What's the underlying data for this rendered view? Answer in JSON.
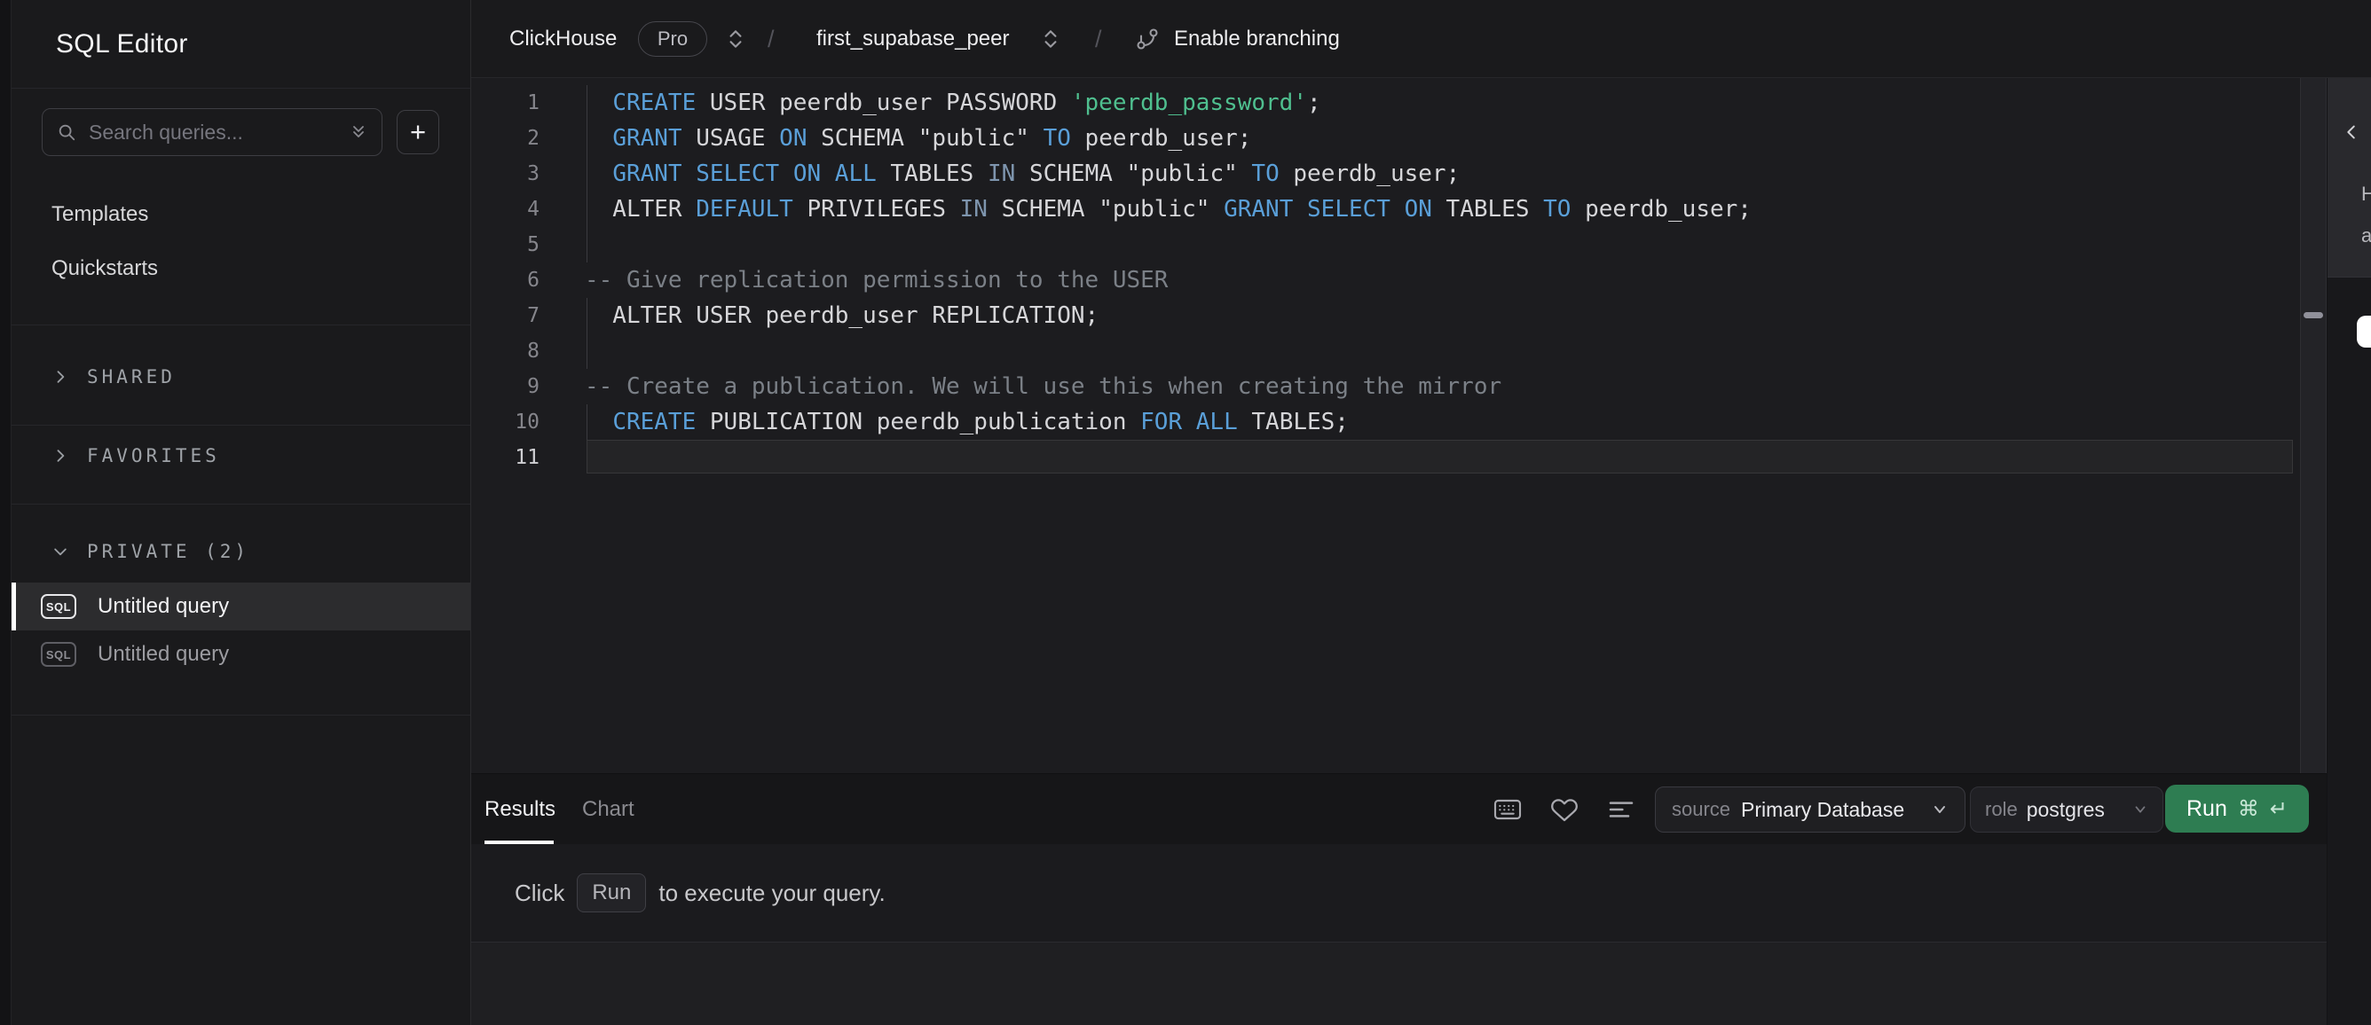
{
  "app": {
    "title": "SQL Editor"
  },
  "topbar": {
    "service": "ClickHouse",
    "plan": "Pro",
    "separator": "/",
    "database": "first_supabase_peer",
    "branching": "Enable branching"
  },
  "sidebar": {
    "search_placeholder": "Search queries...",
    "new_query": "+",
    "nav": [
      {
        "label": "Templates"
      },
      {
        "label": "Quickstarts"
      }
    ],
    "sections": [
      {
        "label": "SHARED"
      },
      {
        "label": "FAVORITES"
      },
      {
        "label": "PRIVATE (2)"
      }
    ],
    "queries": [
      {
        "badge": "SQL",
        "label": "Untitled query",
        "selected": true
      },
      {
        "badge": "SQL",
        "label": "Untitled query",
        "selected": false
      }
    ]
  },
  "editor": {
    "lines": [
      {
        "no": "1",
        "guide": true,
        "tokens": [
          [
            "  ",
            "d"
          ],
          [
            "CREATE",
            "kw"
          ],
          [
            " USER peerdb_user PASSWORD ",
            "d"
          ],
          [
            "'peerdb_password'",
            "str"
          ],
          [
            ";",
            "d"
          ]
        ]
      },
      {
        "no": "2",
        "guide": true,
        "tokens": [
          [
            "  ",
            "d"
          ],
          [
            "GRANT",
            "kw"
          ],
          [
            " USAGE ",
            "d"
          ],
          [
            "ON",
            "kw"
          ],
          [
            " SCHEMA \"public\" ",
            "d"
          ],
          [
            "TO",
            "kw"
          ],
          [
            " peerdb_user;",
            "d"
          ]
        ]
      },
      {
        "no": "3",
        "guide": true,
        "tokens": [
          [
            "  ",
            "d"
          ],
          [
            "GRANT",
            "kw"
          ],
          [
            " ",
            "d"
          ],
          [
            "SELECT",
            "kw"
          ],
          [
            " ",
            "d"
          ],
          [
            "ON",
            "kw"
          ],
          [
            " ",
            "d"
          ],
          [
            "ALL",
            "kw"
          ],
          [
            " TABLES ",
            "d"
          ],
          [
            "IN",
            "kw2"
          ],
          [
            " SCHEMA \"public\" ",
            "d"
          ],
          [
            "TO",
            "kw"
          ],
          [
            " peerdb_user;",
            "d"
          ]
        ]
      },
      {
        "no": "4",
        "guide": true,
        "tokens": [
          [
            "  ALTER ",
            "d"
          ],
          [
            "DEFAULT",
            "kw"
          ],
          [
            " PRIVILEGES ",
            "d"
          ],
          [
            "IN",
            "kw2"
          ],
          [
            " SCHEMA \"public\" ",
            "d"
          ],
          [
            "GRANT",
            "kw"
          ],
          [
            " ",
            "d"
          ],
          [
            "SELECT",
            "kw"
          ],
          [
            " ",
            "d"
          ],
          [
            "ON",
            "kw"
          ],
          [
            " TABLES ",
            "d"
          ],
          [
            "TO",
            "kw"
          ],
          [
            " peerdb_user;",
            "d"
          ]
        ]
      },
      {
        "no": "5",
        "guide": true,
        "tokens": []
      },
      {
        "no": "6",
        "guide": false,
        "tokens": [
          [
            "-- Give replication permission to the USER",
            "com"
          ]
        ]
      },
      {
        "no": "7",
        "guide": true,
        "tokens": [
          [
            "  ALTER USER peerdb_user REPLICATION;",
            "d"
          ]
        ]
      },
      {
        "no": "8",
        "guide": true,
        "tokens": []
      },
      {
        "no": "9",
        "guide": false,
        "tokens": [
          [
            "-- Create a publication. We will use this when creating the mirror",
            "com"
          ]
        ]
      },
      {
        "no": "10",
        "guide": true,
        "tokens": [
          [
            "  ",
            "d"
          ],
          [
            "CREATE",
            "kw"
          ],
          [
            " PUBLICATION peerdb_publication ",
            "d"
          ],
          [
            "FOR",
            "kw"
          ],
          [
            " ",
            "d"
          ],
          [
            "ALL",
            "kw"
          ],
          [
            " TABLES;",
            "d"
          ]
        ]
      },
      {
        "no": "11",
        "guide": false,
        "active": true,
        "tokens": []
      }
    ]
  },
  "results_panel": {
    "tabs": [
      {
        "label": "Results",
        "active": true
      },
      {
        "label": "Chart",
        "active": false
      }
    ],
    "source_label": "source",
    "source_value": "Primary Database",
    "role_label": "role",
    "role_value": "postgres",
    "run_label": "Run",
    "run_shortcut": [
      "⌘",
      "↵"
    ],
    "message": {
      "prefix": "Click",
      "key": "Run",
      "suffix": "to execute your query."
    }
  },
  "right_panel": {
    "collapse_glyph": "‹",
    "clipped_text": [
      "H",
      "a"
    ]
  },
  "colors": {
    "accent_run_green": "#2e7d52",
    "keyword_blue": "#5a9fd8",
    "muted_keyword": "#7e95ae",
    "string_green": "#4fbf8f",
    "comment_gray": "#7b8087",
    "tab_underline": "#ffffff",
    "selected_row_bg": "#2c2c2e"
  }
}
